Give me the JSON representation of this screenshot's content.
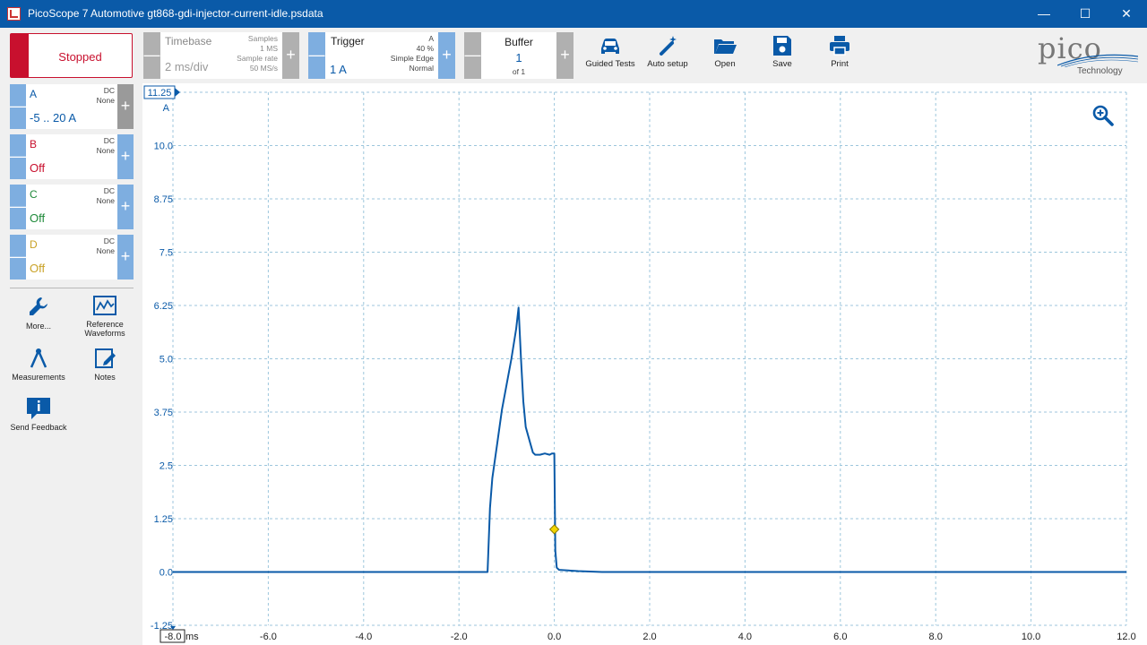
{
  "window": {
    "title": "PicoScope 7 Automotive gt868-gdi-injector-current-idle.psdata"
  },
  "run": {
    "status_label": "Stopped"
  },
  "timebase": {
    "label": "Timebase",
    "value": "2 ms/div",
    "samples_label": "Samples",
    "samples_value": "1 MS",
    "rate_label": "Sample rate",
    "rate_value": "50 MS/s"
  },
  "trigger": {
    "label": "Trigger",
    "value": "1 A",
    "channel": "A",
    "pre": "40 %",
    "type": "Simple Edge",
    "mode": "Normal"
  },
  "buffer": {
    "label": "Buffer",
    "value": "1",
    "of": "of 1"
  },
  "toolbar": {
    "guided": "Guided Tests",
    "autosetup": "Auto setup",
    "open": "Open",
    "save": "Save",
    "print": "Print"
  },
  "logo": {
    "brand": "pico",
    "sub": "Technology"
  },
  "channels": [
    {
      "name": "A",
      "coupling": "DC",
      "probe": "None",
      "range": "-5 .. 20 A",
      "color": "#0a5aa8"
    },
    {
      "name": "B",
      "coupling": "DC",
      "probe": "None",
      "range": "Off",
      "color": "#c8102e"
    },
    {
      "name": "C",
      "coupling": "DC",
      "probe": "None",
      "range": "Off",
      "color": "#1f8a3a"
    },
    {
      "name": "D",
      "coupling": "DC",
      "probe": "None",
      "range": "Off",
      "color": "#c9a227"
    }
  ],
  "sidebar": {
    "more": "More...",
    "reference": "Reference Waveforms",
    "measurements": "Measurements",
    "notes": "Notes",
    "feedback": "Send Feedback"
  },
  "chart_data": {
    "type": "line",
    "xlabel": "ms",
    "ylabel": "A",
    "xlim": [
      -8.0,
      12.0
    ],
    "ylim": [
      -1.25,
      11.25
    ],
    "x_ticks": [
      "-8.0",
      "-6.0",
      "-4.0",
      "-2.0",
      "0.0",
      "2.0",
      "4.0",
      "6.0",
      "8.0",
      "10.0",
      "12.0"
    ],
    "y_ticks": [
      "11.25",
      "10.0",
      "8.75",
      "7.5",
      "6.25",
      "5.0",
      "3.75",
      "2.5",
      "1.25",
      "0.0",
      "-1.25"
    ],
    "grid": true,
    "trigger_point": {
      "x": 0.0,
      "y": 1.0
    },
    "series": [
      {
        "color": "#0a5aa8",
        "x": [
          -8.0,
          -1.4,
          -1.35,
          -1.3,
          -1.2,
          -1.1,
          -1.0,
          -0.9,
          -0.8,
          -0.75,
          -0.7,
          -0.65,
          -0.6,
          -0.5,
          -0.45,
          -0.4,
          -0.3,
          -0.2,
          -0.1,
          -0.05,
          0.0,
          0.02,
          0.05,
          0.1,
          0.5,
          1.0,
          12.0
        ],
        "y": [
          0.0,
          0.0,
          1.5,
          2.2,
          3.0,
          3.8,
          4.4,
          5.0,
          5.7,
          6.2,
          5.0,
          4.0,
          3.4,
          3.0,
          2.8,
          2.75,
          2.75,
          2.78,
          2.75,
          2.78,
          2.78,
          0.5,
          0.1,
          0.05,
          0.02,
          0.0,
          0.0
        ]
      }
    ]
  }
}
